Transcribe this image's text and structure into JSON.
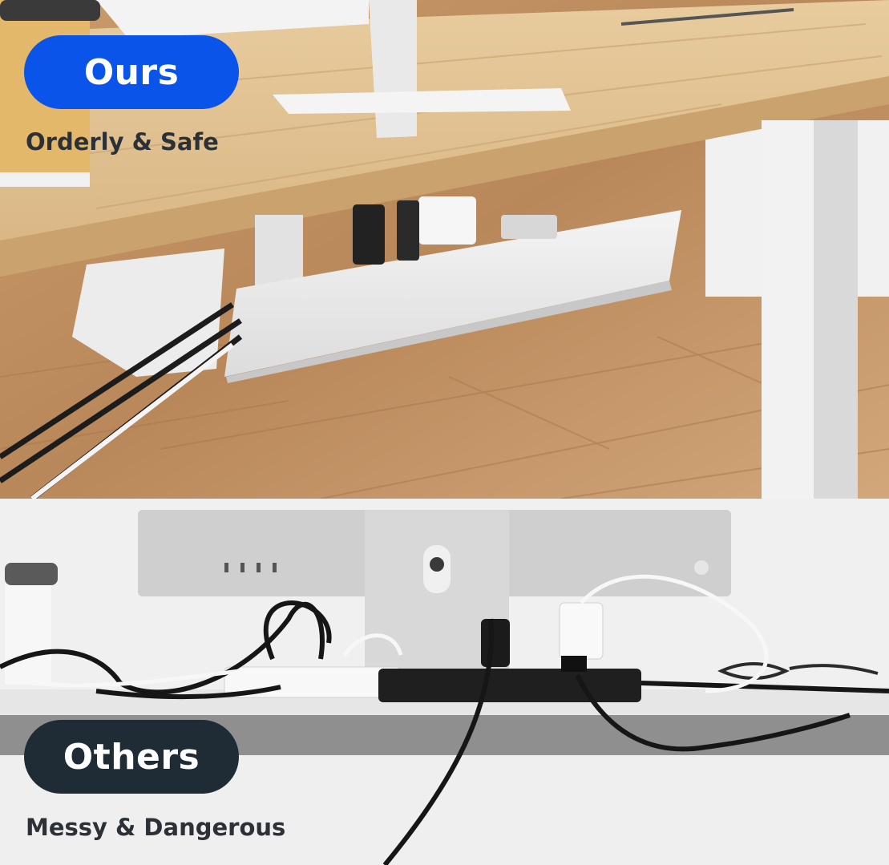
{
  "comparison": {
    "ours": {
      "badge": "Ours",
      "caption": "Orderly & Safe"
    },
    "others": {
      "badge": "Others",
      "caption": "Messy & Dangerous"
    }
  },
  "colors": {
    "ours_badge": "#0a54ea",
    "others_badge": "#1f2b35",
    "caption_text": "#2b3137"
  }
}
